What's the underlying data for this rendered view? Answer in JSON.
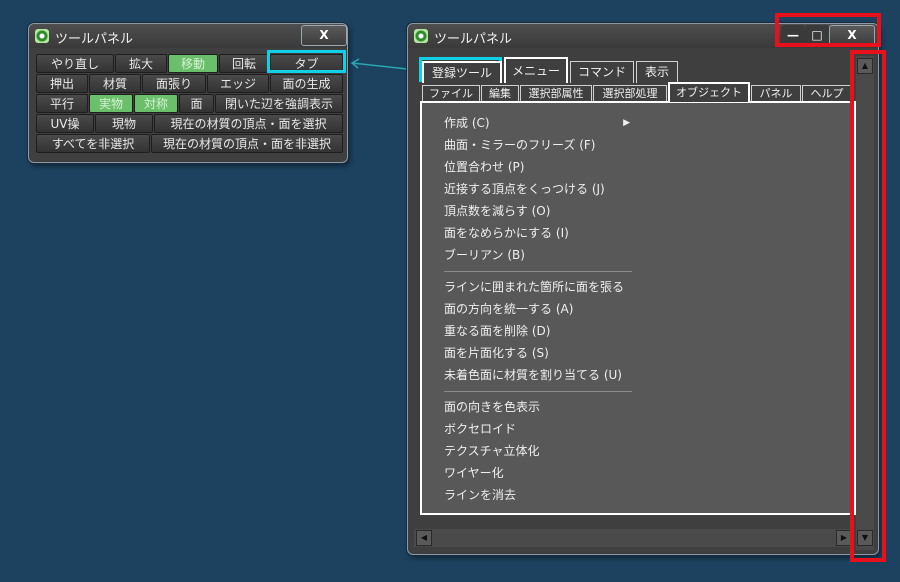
{
  "left_panel": {
    "title": "ツールパネル",
    "close_label": "X",
    "buttons": [
      "やり直し",
      "拡大",
      "移動",
      "回転",
      "タブ",
      "押出",
      "材質",
      "面張り",
      "エッジ",
      "面の生成",
      "平行",
      "実物",
      "対称",
      "面",
      "閉いた辺を強調表示",
      "UV操",
      "現物",
      "現在の材質の頂点・面を選択",
      "すべてを非選択",
      "現在の材質の頂点・面を非選択"
    ]
  },
  "right_panel": {
    "title": "ツールパネル",
    "minimize_label": "—",
    "maximize_label": "□",
    "close_label": "X",
    "tabs_row1": [
      "登録ツール",
      "メニュー",
      "コマンド",
      "表示"
    ],
    "tabs_row2": [
      "ファイル",
      "編集",
      "選択部属性",
      "選択部処理",
      "オブジェクト",
      "パネル",
      "ヘルプ"
    ],
    "menu_group1": [
      "作成 (C)",
      "曲面・ミラーのフリーズ (F)",
      "位置合わせ (P)",
      "近接する頂点をくっつける (J)",
      "頂点数を減らす (O)",
      "面をなめらかにする (I)",
      "ブーリアン (B)"
    ],
    "submenu_arrow": "▶",
    "menu_group2": [
      "ラインに囲まれた箇所に面を張る",
      "面の方向を統一する (A)",
      "重なる面を削除 (D)",
      "面を片面化する (S)",
      "未着色面に材質を割り当てる (U)"
    ],
    "menu_group3": [
      "面の向きを色表示",
      "ボクセロイド",
      "テクスチャ立体化",
      "ワイヤー化",
      "ラインを消去"
    ],
    "scroll_up": "▲",
    "scroll_down": "▼",
    "scroll_left": "◀",
    "scroll_right": "▶"
  },
  "colors": {
    "background": "#1c4260",
    "highlight_cyan": "#10d0e8",
    "highlight_red": "#e8101a",
    "toggle_green": "#6bbf6b"
  }
}
